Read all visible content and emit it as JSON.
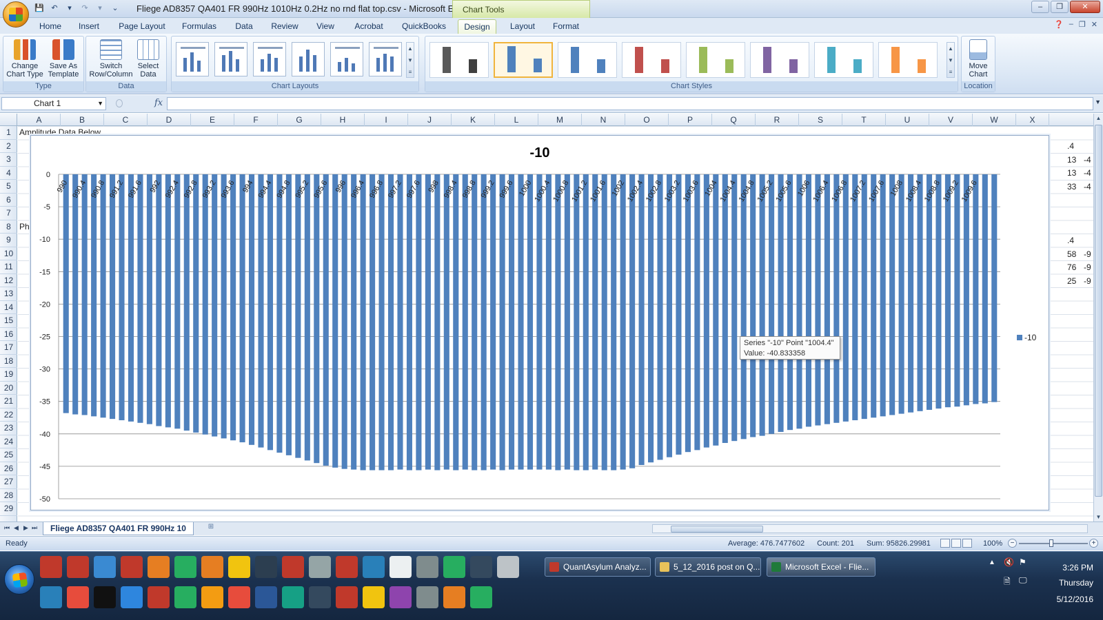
{
  "window": {
    "title": "Fliege AD8357 QA401 FR 990Hz 1010Hz 0.2Hz no rnd flat top.csv - Microsoft Excel",
    "context_label": "Chart Tools",
    "controls": [
      "–",
      "❐",
      "✕"
    ]
  },
  "tabs": [
    {
      "label": "Home",
      "active": false
    },
    {
      "label": "Insert",
      "active": false
    },
    {
      "label": "Page Layout",
      "active": false
    },
    {
      "label": "Formulas",
      "active": false
    },
    {
      "label": "Data",
      "active": false
    },
    {
      "label": "Review",
      "active": false
    },
    {
      "label": "View",
      "active": false
    },
    {
      "label": "Acrobat",
      "active": false
    },
    {
      "label": "QuickBooks",
      "active": false
    },
    {
      "label": "Design",
      "active": true
    },
    {
      "label": "Layout",
      "active": false
    },
    {
      "label": "Format",
      "active": false
    }
  ],
  "ribbon": {
    "type_group": {
      "label": "Type",
      "change_chart_type": "Change Chart Type",
      "save_as_template": "Save As Template"
    },
    "data_group": {
      "label": "Data",
      "switch_row_column": "Switch Row/Column",
      "select_data": "Select Data"
    },
    "layouts_group": {
      "label": "Chart Layouts"
    },
    "styles_group": {
      "label": "Chart Styles",
      "styles": [
        {
          "color1": "#595959",
          "color2": "#404040"
        },
        {
          "color1": "#4f81bd",
          "color2": "#4f81bd"
        },
        {
          "color1": "#4f81bd",
          "color2": "#4f81bd"
        },
        {
          "color1": "#c0504d",
          "color2": "#c0504d"
        },
        {
          "color1": "#9bbb59",
          "color2": "#9bbb59"
        },
        {
          "color1": "#8064a2",
          "color2": "#8064a2"
        },
        {
          "color1": "#4bacc6",
          "color2": "#4bacc6"
        },
        {
          "color1": "#f79646",
          "color2": "#f79646"
        }
      ]
    },
    "location_group": {
      "label": "Location",
      "move_chart": "Move Chart"
    }
  },
  "formula_bar": {
    "name_box": "Chart 1",
    "fx": "fx",
    "value": ""
  },
  "columns": [
    "A",
    "B",
    "C",
    "D",
    "E",
    "F",
    "G",
    "H",
    "I",
    "J",
    "K",
    "L",
    "M",
    "N",
    "O",
    "P",
    "Q",
    "R",
    "S",
    "T",
    "U",
    "V",
    "W",
    "X"
  ],
  "rows": [
    "1",
    "2",
    "3",
    "4",
    "5",
    "6",
    "7",
    "8",
    "9",
    "10",
    "11",
    "12",
    "13",
    "14",
    "15",
    "16",
    "17",
    "18",
    "19",
    "20",
    "21",
    "22",
    "23",
    "24",
    "25",
    "26",
    "27",
    "28",
    "29"
  ],
  "cells": {
    "a1": "Amplitude Data Below",
    "a8": "Pha",
    "x2": ".4",
    "x3": "13",
    "x3b": "-4",
    "x4": "13",
    "x4b": "-4",
    "x5": "33",
    "x5b": "-4",
    "x9": ".4",
    "x10": "58",
    "x10b": "-9",
    "x11": "76",
    "x11b": "-9",
    "x12": "25",
    "x12b": "-9"
  },
  "chart_data": {
    "type": "bar",
    "title": "-10",
    "xlabel": "",
    "ylabel": "",
    "ylim": [
      -50,
      0
    ],
    "yticks": [
      0,
      -5,
      -10,
      -15,
      -20,
      -25,
      -30,
      -35,
      -40,
      -45,
      -50
    ],
    "grid": true,
    "legend": "right",
    "category_start": 990,
    "category_step": 0.2,
    "category_count": 101,
    "tick_labels": [
      "990",
      "990.4",
      "990.8",
      "991.2",
      "991.6",
      "992",
      "992.4",
      "992.8",
      "993.2",
      "993.6",
      "994",
      "994.4",
      "994.8",
      "995.2",
      "995.6",
      "996",
      "996.4",
      "996.8",
      "997.2",
      "997.6",
      "998",
      "998.4",
      "998.8",
      "999.2",
      "999.6",
      "1000",
      "1000.4",
      "1000.8",
      "1001.2",
      "1001.6",
      "1002",
      "1002.4",
      "1002.8",
      "1003.2",
      "1003.6",
      "1004",
      "1004.4",
      "1004.8",
      "1005.2",
      "1005.6",
      "1006",
      "1006.4",
      "1006.8",
      "1007.2",
      "1007.6",
      "1008",
      "1008.4",
      "1008.8",
      "1009.2",
      "1009.6"
    ],
    "series": [
      {
        "name": "-10",
        "color": "#4f81bd",
        "values": [
          -36.8,
          -37.0,
          -37.1,
          -37.3,
          -37.5,
          -37.7,
          -37.9,
          -38.1,
          -38.3,
          -38.5,
          -38.8,
          -39.0,
          -39.2,
          -39.5,
          -39.8,
          -40.1,
          -40.4,
          -40.7,
          -41.0,
          -41.3,
          -41.7,
          -42.1,
          -42.5,
          -42.9,
          -43.3,
          -43.7,
          -44.1,
          -44.5,
          -44.9,
          -45.2,
          -45.4,
          -45.5,
          -45.6,
          -45.6,
          -45.6,
          -45.6,
          -45.5,
          -45.6,
          -45.6,
          -45.5,
          -45.6,
          -45.5,
          -45.6,
          -45.5,
          -45.6,
          -45.6,
          -45.5,
          -45.6,
          -45.5,
          -45.5,
          -45.5,
          -45.5,
          -45.5,
          -45.6,
          -45.5,
          -45.6,
          -45.6,
          -45.5,
          -45.6,
          -45.6,
          -45.5,
          -45.3,
          -44.8,
          -44.4,
          -44.0,
          -43.6,
          -43.2,
          -42.8,
          -42.5,
          -42.1,
          -41.8,
          -41.4,
          -41.1,
          -40.8,
          -40.5,
          -40.3,
          -40.0,
          -39.7,
          -39.4,
          -39.2,
          -38.9,
          -38.7,
          -38.5,
          -38.3,
          -38.1,
          -37.9,
          -37.7,
          -37.5,
          -37.3,
          -37.1,
          -36.9,
          -36.7,
          -36.5,
          -36.3,
          -36.1,
          -35.9,
          -35.8,
          -35.6,
          -35.4,
          -35.3,
          -35.1
        ]
      }
    ]
  },
  "tooltip": {
    "line1": "Series \"-10\" Point \"1004.4\"",
    "line2": "Value: -40.833358"
  },
  "sheet_tab": "Fliege AD8357 QA401 FR 990Hz 10",
  "status": {
    "ready": "Ready",
    "average": "Average: 476.7477602",
    "count": "Count: 201",
    "sum": "Sum: 95826.29981",
    "zoom": "100%"
  },
  "taskbar": {
    "tasks": [
      {
        "label": "QuantAsylum Analyz...",
        "icon_color": "#c0392b"
      },
      {
        "label": "5_12_2016 post on Q...",
        "icon_color": "#e8c25a"
      },
      {
        "label": "Microsoft Excel - Flie...",
        "icon_color": "#1f7a3a"
      }
    ],
    "clock_time": "3:26 PM",
    "clock_day": "Thursday",
    "clock_date": "5/12/2016"
  }
}
